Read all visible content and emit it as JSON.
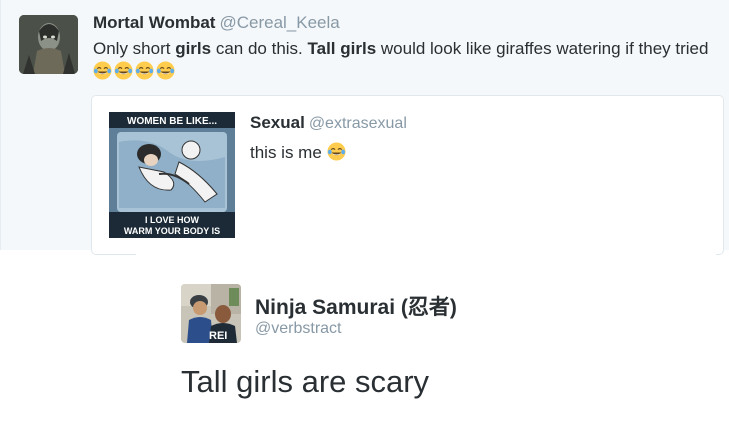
{
  "top_tweet": {
    "author_name": "Mortal Wombat",
    "author_handle": "@Cereal_Keela",
    "text_parts": [
      "Only short ",
      "girls",
      " can do this. ",
      "Tall girls",
      " would look like giraffes watering if they tried "
    ],
    "emoji": "face-with-tears-of-joy",
    "emoji_count": 4
  },
  "quoted_tweet": {
    "author_name": "Sexual",
    "author_handle": "@extrasexual",
    "text": "this is me",
    "emoji": "face-with-tears-of-joy",
    "media": {
      "caption_top": "WOMEN BE LIKE...",
      "caption_bottom_1": "I LOVE HOW",
      "caption_bottom_2": "WARM YOUR BODY IS"
    }
  },
  "bottom_tweet": {
    "author_name": "Ninja Samurai (忍者)",
    "author_handle": "@verbstract",
    "text": "Tall girls are scary"
  },
  "colors": {
    "text": "#292f33",
    "handle": "#8899a6",
    "top_background": "#f5f8fa",
    "card_border": "#e1e8ed",
    "emoji_yellow": "#ffcc4d"
  }
}
